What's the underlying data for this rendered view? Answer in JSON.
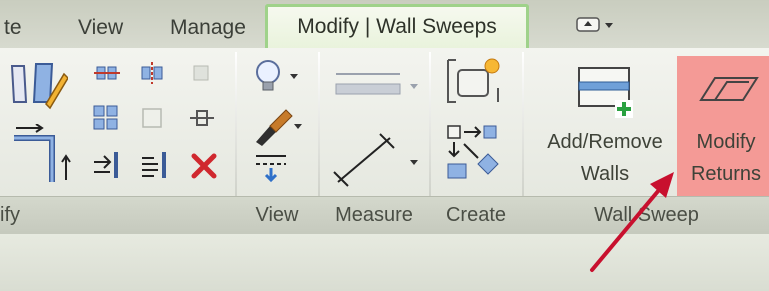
{
  "tabs": [
    {
      "label": "te"
    },
    {
      "label": "View"
    },
    {
      "label": "Manage"
    },
    {
      "label": "Modify | Wall Sweeps"
    }
  ],
  "panels": {
    "modify_label": "ify",
    "view_label": "View",
    "measure_label": "Measure",
    "create_label": "Create",
    "wall_sweep_label": "Wall Sweep"
  },
  "buttons": {
    "add_remove_walls": "Add/Remove\nWalls",
    "add_remove_line1": "Add/Remove",
    "add_remove_line2": "Walls",
    "modify_returns_line1": "Modify",
    "modify_returns_line2": "Returns"
  },
  "colors": {
    "active_tab_border": "#9fd28a",
    "highlight": "#f49a96",
    "arrow": "#c8102e"
  }
}
